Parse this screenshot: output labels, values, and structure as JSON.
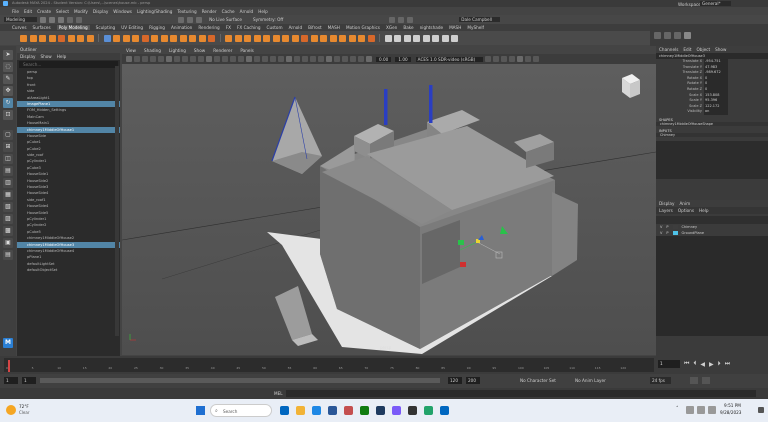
{
  "title_bar": {
    "title": "Autodesk MAYA 2024 - Student Version: C:\\Users\\...\\scenes\\house.mb - persp",
    "workspace_label": "Workspace :",
    "workspace_value": "General*"
  },
  "menu": [
    "File",
    "Edit",
    "Create",
    "Select",
    "Modify",
    "Display",
    "Windows",
    "Lighting/Shading",
    "Texturing",
    "Render",
    "Cache",
    "Arnold",
    "Help"
  ],
  "status_line": {
    "mode": "Modeling",
    "live_surface": "No Live Surface",
    "symmetry": "Symmetry: Off",
    "user": "Dale Campbell"
  },
  "shelf_tabs": [
    "Curves",
    "Surfaces",
    "Poly Modeling",
    "Sculpting",
    "UV Editing",
    "Rigging",
    "Animation",
    "Rendering",
    "FX",
    "FX Caching",
    "Custom",
    "Arnold",
    "Bifrost",
    "MASH",
    "Motion Graphics",
    "XGen",
    "Bake",
    "nightshade",
    "MASH",
    "MyShelf"
  ],
  "shelf_colors": [
    "#e7892f",
    "#e7892f",
    "#e7892f",
    "#e7892f",
    "#d7682a",
    "#e7892f",
    "#e7892f",
    "#e7892f",
    "#5a8fd6",
    "#e7892f",
    "#e7892f",
    "#e7892f",
    "#d7682a",
    "#e7892f",
    "#e7892f",
    "#e7892f",
    "#e7892f",
    "#e7892f",
    "#e7892f",
    "#d7682a",
    "#e7892f",
    "#e7892f",
    "#e7892f",
    "#e7892f",
    "#e7892f",
    "#e7892f",
    "#e7892f",
    "#e7892f",
    "#d7682a",
    "#e7892f",
    "#e7892f",
    "#e7892f",
    "#e7892f",
    "#e7892f",
    "#e7892f",
    "#d7682a",
    "#cfcfcf",
    "#cfcfcf",
    "#cfcfcf",
    "#cfcfcf",
    "#cfcfcf",
    "#cfcfcf",
    "#cfcfcf",
    "#cfcfcf"
  ],
  "outliner": {
    "title": "Outliner",
    "menu": [
      "Display",
      "Show",
      "Help"
    ],
    "search_placeholder": "Search...",
    "items": [
      {
        "label": "persp",
        "selected": false
      },
      {
        "label": "top",
        "selected": false
      },
      {
        "label": "front",
        "selected": false
      },
      {
        "label": "side",
        "selected": false
      },
      {
        "label": "aiAreaLight1",
        "selected": false
      },
      {
        "label": "imagePlane1",
        "selected": true
      },
      {
        "label": "FOM_Hidden_Settings",
        "selected": false
      },
      {
        "label": "MainCam",
        "selected": false
      },
      {
        "label": "HouseMain1",
        "selected": false
      },
      {
        "label": "chimney1MiddleOfHouse1",
        "selected": true
      },
      {
        "label": "HouseSide",
        "selected": false
      },
      {
        "label": "pCube1",
        "selected": false
      },
      {
        "label": "pCube2",
        "selected": false
      },
      {
        "label": "side_roof",
        "selected": false
      },
      {
        "label": "pCylinder1",
        "selected": false
      },
      {
        "label": "pCube3",
        "selected": false
      },
      {
        "label": "HouseSide1",
        "selected": false
      },
      {
        "label": "HouseSide2",
        "selected": false
      },
      {
        "label": "HouseSide3",
        "selected": false
      },
      {
        "label": "HouseSide4",
        "selected": false
      },
      {
        "label": "side_roof1",
        "selected": false
      },
      {
        "label": "HouseSide4",
        "selected": false
      },
      {
        "label": "HouseSide5",
        "selected": false
      },
      {
        "label": "pCylinder1",
        "selected": false
      },
      {
        "label": "pCylinder2",
        "selected": false
      },
      {
        "label": "pCube5",
        "selected": false
      },
      {
        "label": "chimney1MiddleOfHouse2",
        "selected": false
      },
      {
        "label": "chimney1MiddleOfHouse3",
        "selected": true
      },
      {
        "label": "chimney1MiddleOfHouse4",
        "selected": false
      },
      {
        "label": "pPlane1",
        "selected": false
      },
      {
        "label": "defaultLightSet",
        "selected": false
      },
      {
        "label": "defaultObjectSet",
        "selected": false
      }
    ]
  },
  "viewport": {
    "menu": [
      "View",
      "Shading",
      "Lighting",
      "Show",
      "Renderer",
      "Panels"
    ],
    "camera_label": "persp",
    "colorspace": "ACES 1.0 SDR-video (sRGB)",
    "near_value": "0.00",
    "far_value": "1.00"
  },
  "channel_box": {
    "tabs": [
      "Channels",
      "Edit",
      "Object",
      "Show"
    ],
    "object_name": "chimney1MiddleOfHouse3",
    "attributes": [
      {
        "name": "Translate X",
        "value": "-954.751"
      },
      {
        "name": "Translate Y",
        "value": "47.983"
      },
      {
        "name": "Translate Z",
        "value": "-989.672"
      },
      {
        "name": "Rotate X",
        "value": "0"
      },
      {
        "name": "Rotate Y",
        "value": "0"
      },
      {
        "name": "Rotate Z",
        "value": "0"
      },
      {
        "name": "Scale X",
        "value": "153.808"
      },
      {
        "name": "Scale Y",
        "value": "95.396"
      },
      {
        "name": "Scale Z",
        "value": "122.172"
      },
      {
        "name": "Visibility",
        "value": "on"
      }
    ],
    "shapes_label": "SHAPES",
    "shape_name": "chimney1MiddleOfHouseShape",
    "inputs_label": "INPUTS",
    "input_name": "Chimney"
  },
  "layer_editor": {
    "menu": [
      "Display",
      "Anim"
    ],
    "sub_menu": [
      "Layers",
      "Options",
      "Help"
    ],
    "layers": [
      {
        "v": "V",
        "p": "P",
        "name": "Chimney",
        "color": "#3d3d3d"
      },
      {
        "v": "V",
        "p": "P",
        "name": "GroundPlane",
        "color": "#4fc3e8"
      }
    ]
  },
  "timeline": {
    "ticks": [
      "0",
      "5",
      "10",
      "15",
      "20",
      "25",
      "30",
      "35",
      "40",
      "45",
      "50",
      "55",
      "60",
      "65",
      "70",
      "75",
      "80",
      "85",
      "90",
      "95",
      "100",
      "105",
      "110",
      "115",
      "120"
    ],
    "current_frame": "1",
    "range_start": "1",
    "range_end": "120",
    "anim_end": "200",
    "character_set": "No Character Set",
    "anim_layer": "No Anim Layer",
    "fps": "24 fps"
  },
  "mel": {
    "label": "MEL"
  },
  "taskbar": {
    "weather_temp": "72°F",
    "weather_desc": "Clear",
    "search_placeholder": "Search",
    "time": "9:51 PM",
    "date": "9/28/2023",
    "app_colors": [
      "#0067c0",
      "#f2b336",
      "#1e88e5",
      "#2b5797",
      "#c44f4f",
      "#107c10",
      "#1e3a5f",
      "#7a5af8",
      "#333333",
      "#22a36a",
      "#0067c0"
    ]
  }
}
